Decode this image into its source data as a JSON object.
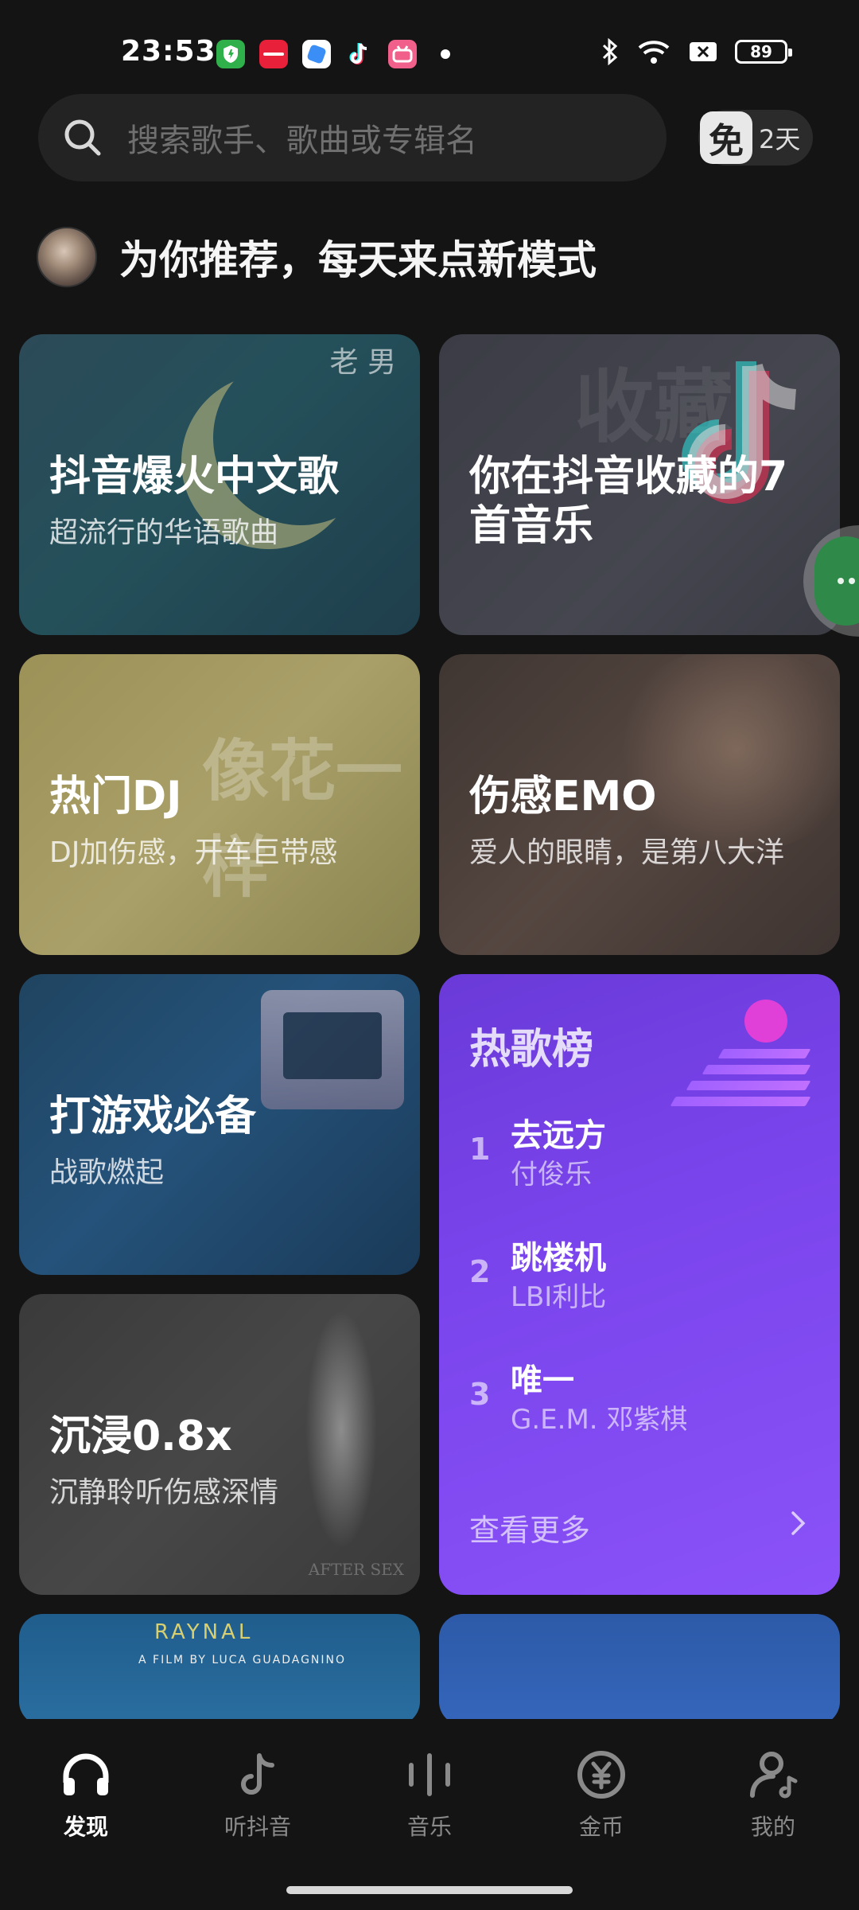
{
  "status_bar": {
    "time": "23:53",
    "battery": "89",
    "app_icons": [
      "security-app",
      "xiaohongshu",
      "browser",
      "tiktok",
      "bilibili"
    ]
  },
  "search": {
    "placeholder": "搜索歌手、歌曲或专辑名"
  },
  "vip": {
    "badge": "免",
    "days": "2天"
  },
  "recommend": {
    "title": "为你推荐，每天来点新模式"
  },
  "cards": [
    {
      "title": "抖音爆火中文歌",
      "subtitle": "超流行的华语歌曲"
    },
    {
      "title": "你在抖音收藏的7首音乐",
      "subtitle": ""
    },
    {
      "title": "热门DJ",
      "subtitle": "DJ加伤感，开车巨带感"
    },
    {
      "title": "伤感EMO",
      "subtitle": "爱人的眼睛，是第八大洋"
    },
    {
      "title": "打游戏必备",
      "subtitle": "战歌燃起"
    },
    {
      "title": "沉浸0.8x",
      "subtitle": "沉静聆听伤感深情"
    }
  ],
  "card_art_text": {
    "c1": "老 男",
    "c2": "收藏",
    "c3": "像花一样",
    "c6": "AFTER SEX",
    "c7_title": "RAYNAL",
    "c7_sub": "A FILM BY LUCA GUADAGNINO"
  },
  "hot_chart": {
    "title": "热歌榜",
    "songs": [
      {
        "rank": "1",
        "name": "去远方",
        "artist": "付俊乐"
      },
      {
        "rank": "2",
        "name": "跳楼机",
        "artist": "LBI利比"
      },
      {
        "rank": "3",
        "name": "唯一",
        "artist": "G.E.M. 邓紫棋"
      }
    ],
    "see_more": "查看更多"
  },
  "bottom_nav": [
    {
      "label": "发现",
      "icon": "headphones-icon",
      "active": true
    },
    {
      "label": "听抖音",
      "icon": "tiktok-note-icon",
      "active": false
    },
    {
      "label": "音乐",
      "icon": "music-bars-icon",
      "active": false
    },
    {
      "label": "金币",
      "icon": "yuan-coin-icon",
      "active": false
    },
    {
      "label": "我的",
      "icon": "profile-music-icon",
      "active": false
    }
  ],
  "colors": {
    "background": "#141414",
    "chart_purple": "#7a44ec",
    "accent_pink": "#e040d8"
  }
}
